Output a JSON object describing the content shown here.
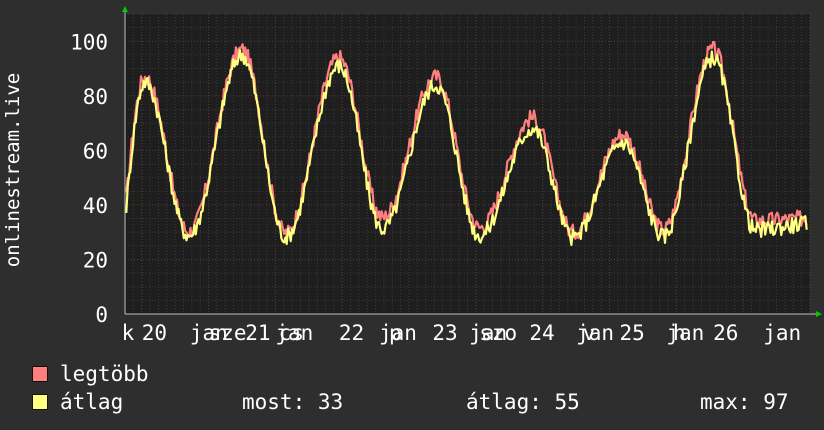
{
  "chart_data": {
    "type": "line",
    "ylabel": "onlinestream.live",
    "ylim": [
      0,
      110
    ],
    "yticks": [
      0,
      20,
      40,
      60,
      80,
      100
    ],
    "grid": true,
    "x_tick_labels": [
      {
        "label": "k",
        "day": -0.3
      },
      {
        "label": "20",
        "day": 0.0
      },
      {
        "label": "jan",
        "day": 0.72
      },
      {
        "label": "sze",
        "day": 1.0
      },
      {
        "label": "21",
        "day": 1.55
      },
      {
        "label": "jan",
        "day": 2.0
      },
      {
        "label": "cs",
        "day": 2.05
      },
      {
        "label": "22",
        "day": 2.95
      },
      {
        "label": "jan",
        "day": 3.55
      },
      {
        "label": "p",
        "day": 3.7
      },
      {
        "label": "23",
        "day": 4.35
      },
      {
        "label": "jan",
        "day": 4.9
      },
      {
        "label": "szo",
        "day": 5.05
      },
      {
        "label": "24",
        "day": 5.8
      },
      {
        "label": "jan",
        "day": 6.5
      },
      {
        "label": "v",
        "day": 6.6
      },
      {
        "label": "25",
        "day": 7.15
      },
      {
        "label": "jan",
        "day": 7.85
      },
      {
        "label": "h",
        "day": 7.95
      },
      {
        "label": "26",
        "day": 8.55
      },
      {
        "label": "jan",
        "day": 9.3
      }
    ],
    "x_range_days": [
      -0.25,
      10.0
    ],
    "series": [
      {
        "name": "legtöbb",
        "color": "#ff7f7f",
        "peaks": [
          {
            "day": 0.05,
            "min": 37,
            "max": 87
          },
          {
            "day": 1.5,
            "min": 28,
            "max": 97
          },
          {
            "day": 2.95,
            "min": 35,
            "max": 94
          },
          {
            "day": 4.4,
            "min": 37,
            "max": 87
          },
          {
            "day": 5.85,
            "min": 30,
            "max": 72
          },
          {
            "day": 7.2,
            "min": 30,
            "max": 66
          },
          {
            "day": 8.55,
            "min": 34,
            "max": 97
          },
          {
            "day": 9.95,
            "min": 35,
            "max": 35
          }
        ]
      },
      {
        "name": "átlag",
        "color": "#ffff80",
        "peaks": [
          {
            "day": 0.05,
            "min": 34,
            "max": 85
          },
          {
            "day": 1.5,
            "min": 27,
            "max": 95
          },
          {
            "day": 2.95,
            "min": 32,
            "max": 91
          },
          {
            "day": 4.4,
            "min": 31,
            "max": 84
          },
          {
            "day": 5.85,
            "min": 28,
            "max": 68
          },
          {
            "day": 7.2,
            "min": 28,
            "max": 63
          },
          {
            "day": 8.55,
            "min": 30,
            "max": 94
          },
          {
            "day": 9.95,
            "min": 33,
            "max": 33
          }
        ]
      }
    ],
    "stats": {
      "most": 33,
      "atlag": 55,
      "max": 97
    }
  },
  "legend": {
    "max_label": "legtöbb",
    "avg_label": "átlag",
    "most_text": "most: 33",
    "atlag_text": "átlag: 55",
    "max_text": "max: 97"
  },
  "colors": {
    "background": "#2e2e2e",
    "plot_background": "#1e1e1e",
    "max_line": "#ff7f7f",
    "avg_line": "#ffff80",
    "arrow": "#00cc00"
  }
}
